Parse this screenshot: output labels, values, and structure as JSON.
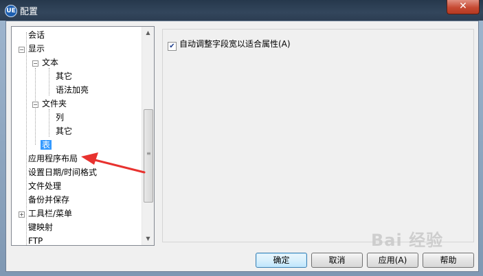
{
  "window": {
    "title": "配置",
    "app_icon": "app-logo-icon",
    "close_symbol": "✕"
  },
  "tree": {
    "items": [
      {
        "label": "会话"
      },
      {
        "label": "显示"
      },
      {
        "label": "文本"
      },
      {
        "label": "其它"
      },
      {
        "label": "语法加亮"
      },
      {
        "label": "文件夹"
      },
      {
        "label": "列"
      },
      {
        "label": "其它"
      },
      {
        "label": "表"
      },
      {
        "label": "应用程序布局"
      },
      {
        "label": "设置日期/时间格式"
      },
      {
        "label": "文件处理"
      },
      {
        "label": "备份并保存"
      },
      {
        "label": "工具栏/菜单"
      },
      {
        "label": "键映射"
      },
      {
        "label": "FTP"
      }
    ],
    "selected_index": 8,
    "scroll_up": "▲",
    "scroll_down": "▼"
  },
  "panel": {
    "auto_fit_label": "自动调整字段宽以适合属性(A)",
    "auto_fit_checked": true
  },
  "buttons": {
    "ok": "确定",
    "cancel": "取消",
    "apply": "应用(A)",
    "help": "帮助"
  },
  "annotation": {
    "arrow_color": "#e8322f"
  },
  "watermark": {
    "text": "Bai 经验"
  }
}
